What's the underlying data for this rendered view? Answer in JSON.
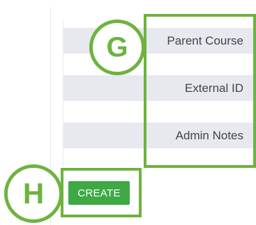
{
  "form": {
    "fields": [
      {
        "label": "Parent Course"
      },
      {
        "label": "External ID"
      },
      {
        "label": "Admin Notes"
      }
    ],
    "create_label": "CREATE"
  },
  "callouts": {
    "g": {
      "letter": "G"
    },
    "h": {
      "letter": "H"
    }
  },
  "colors": {
    "callout_green": "#6db33f",
    "button_green": "#3ea944",
    "row_bg": "#e7e9ee"
  }
}
